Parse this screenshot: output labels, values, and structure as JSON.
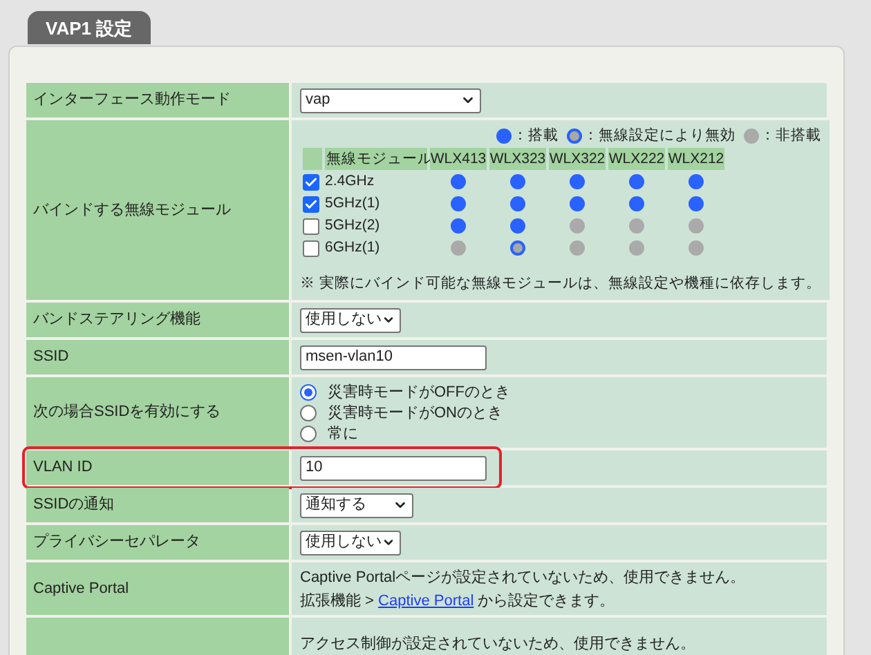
{
  "tab": {
    "title": "VAP1 設定"
  },
  "rows": [
    {
      "kind": "select",
      "label": "インターフェース動作モード",
      "value": "vap"
    },
    {
      "kind": "modules",
      "label": "バインドする無線モジュール",
      "legend": [
        {
          "kind": "on",
          "text": "：搭載"
        },
        {
          "kind": "disabled",
          "text": "：無線設定により無効"
        },
        {
          "kind": "off",
          "text": "：非搭載"
        }
      ],
      "header": "無線モジュール",
      "models": [
        "WLX413",
        "WLX323",
        "WLX322",
        "WLX222",
        "WLX212"
      ],
      "bands": [
        {
          "name": "2.4GHz",
          "checked": true,
          "slots": [
            {
              "kind": "on"
            },
            {
              "kind": "on"
            },
            {
              "kind": "on"
            },
            {
              "kind": "on"
            },
            {
              "kind": "on"
            }
          ]
        },
        {
          "name": "5GHz(1)",
          "checked": true,
          "slots": [
            {
              "kind": "on"
            },
            {
              "kind": "on"
            },
            {
              "kind": "on"
            },
            {
              "kind": "on"
            },
            {
              "kind": "on"
            }
          ]
        },
        {
          "name": "5GHz(2)",
          "checked": false,
          "slots": [
            {
              "kind": "on"
            },
            {
              "kind": "on"
            },
            {
              "kind": "off"
            },
            {
              "kind": "off"
            },
            {
              "kind": "off"
            }
          ]
        },
        {
          "name": "6GHz(1)",
          "checked": false,
          "slots": [
            {
              "kind": "off"
            },
            {
              "kind": "disabled"
            },
            {
              "kind": "off"
            },
            {
              "kind": "off"
            },
            {
              "kind": "off"
            }
          ]
        }
      ],
      "note": "※ 実際にバインド可能な無線モジュールは、無線設定や機種に依存します。"
    },
    {
      "kind": "select",
      "label": "バンドステアリング機能",
      "value": "使用しない"
    },
    {
      "kind": "text",
      "label": "SSID",
      "value": "msen-vlan10"
    },
    {
      "kind": "radios",
      "label": "次の場合SSIDを有効にする",
      "options": [
        {
          "label": "災害時モードがOFFのとき",
          "selected": true
        },
        {
          "label": "災害時モードがONのとき",
          "selected": false
        },
        {
          "label": "常に",
          "selected": false
        }
      ]
    },
    {
      "kind": "text",
      "label": "VLAN ID",
      "value": "10",
      "highlighted": true
    },
    {
      "kind": "select",
      "label": "SSIDの通知",
      "value": "通知する"
    },
    {
      "kind": "select",
      "label": "プライバシーセパレータ",
      "value": "使用しない"
    },
    {
      "kind": "info",
      "label": "Captive Portal",
      "lines": [
        {
          "text": "Captive Portalページが設定されていないため、使用できません。"
        },
        {
          "text": "拡張機能 >",
          "link": "Captive Portal",
          "after": "から設定できます。"
        }
      ]
    },
    {
      "kind": "info",
      "lines": [
        {
          "text": "アクセス制御が設定されていないため、使用できません。"
        }
      ]
    }
  ]
}
